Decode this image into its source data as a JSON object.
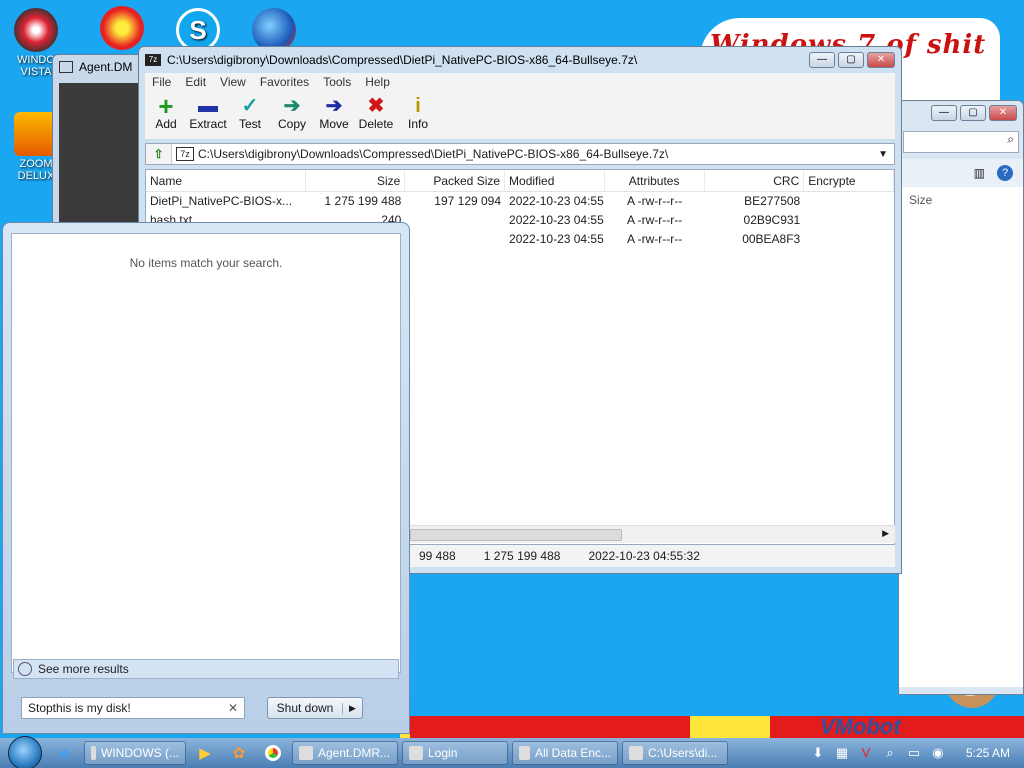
{
  "desktop": {
    "icons": [
      {
        "label": "WINDO VISTA"
      },
      {
        "label": "ZOOM DELUX"
      }
    ],
    "banner_text": "Windows 7 of shit",
    "strip_text": "VMobot"
  },
  "agent_window": {
    "title": "Agent.DM"
  },
  "zip_window": {
    "title": "C:\\Users\\digibrony\\Downloads\\Compressed\\DietPi_NativePC-BIOS-x86_64-Bullseye.7z\\",
    "menu": [
      "File",
      "Edit",
      "View",
      "Favorites",
      "Tools",
      "Help"
    ],
    "toolbar": [
      {
        "label": "Add",
        "icon": "+",
        "color": "#1f9a1f"
      },
      {
        "label": "Extract",
        "icon": "▬",
        "color": "#2233aa"
      },
      {
        "label": "Test",
        "icon": "✓",
        "color": "#18a0a8"
      },
      {
        "label": "Copy",
        "icon": "➔",
        "color": "#1a8a6a"
      },
      {
        "label": "Move",
        "icon": "➔",
        "color": "#1d2aa0"
      },
      {
        "label": "Delete",
        "icon": "✖",
        "color": "#d01818"
      },
      {
        "label": "Info",
        "icon": "i",
        "color": "#b89a00"
      }
    ],
    "address": "C:\\Users\\digibrony\\Downloads\\Compressed\\DietPi_NativePC-BIOS-x86_64-Bullseye.7z\\",
    "columns": [
      "Name",
      "Size",
      "Packed Size",
      "Modified",
      "Attributes",
      "CRC",
      "Encrypte"
    ],
    "rows": [
      {
        "name": "DietPi_NativePC-BIOS-x...",
        "size": "1 275 199 488",
        "packed": "197 129 094",
        "modified": "2022-10-23 04:55",
        "attributes": "A -rw-r--r--",
        "crc": "BE277508",
        "enc": ""
      },
      {
        "name": "hash.txt",
        "size": "240",
        "packed": "",
        "modified": "2022-10-23 04:55",
        "attributes": "A -rw-r--r--",
        "crc": "02B9C931",
        "enc": ""
      },
      {
        "name": "",
        "size": "",
        "packed": "",
        "modified": "2022-10-23 04:55",
        "attributes": "A -rw-r--r--",
        "crc": "00BEA8F3",
        "enc": ""
      }
    ],
    "status": [
      "99 488",
      "1 275 199 488",
      "2022-10-23 04:55:32"
    ]
  },
  "explorer_window": {
    "column_size": "Size"
  },
  "start_menu": {
    "empty_message": "No items match your search.",
    "see_more": "See more results",
    "search_value": "Stopthis is my disk!",
    "shutdown_label": "Shut down"
  },
  "taskbar": {
    "tasks": [
      {
        "label": "WINDOWS (..."
      },
      {
        "label": "Agent.DMR..."
      },
      {
        "label": "Login"
      },
      {
        "label": "All Data Enc..."
      },
      {
        "label": "C:\\Users\\di..."
      }
    ],
    "clock": "5:25 AM"
  }
}
